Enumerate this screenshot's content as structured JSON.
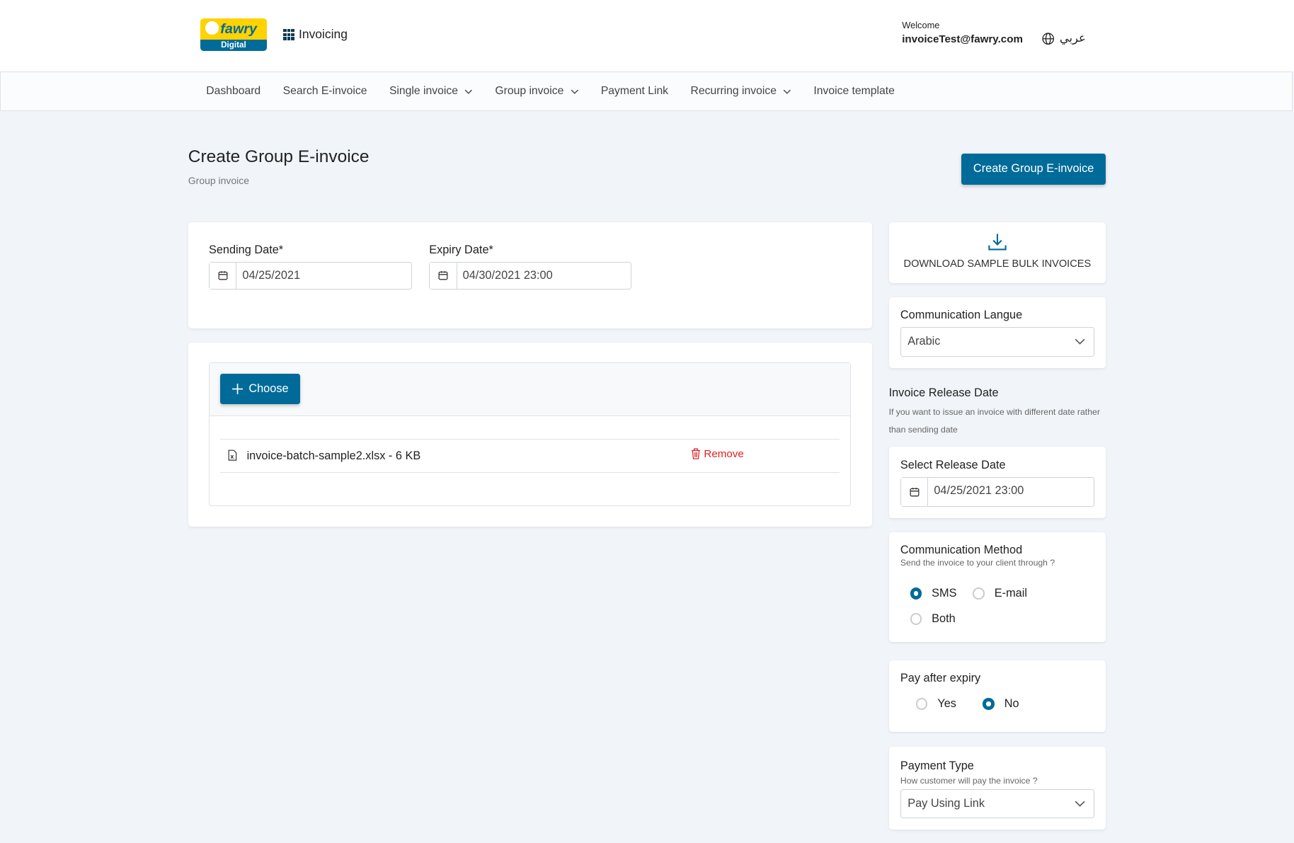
{
  "header": {
    "logo_text": "fawry",
    "logo_sub": "Digital",
    "app_name": "Invoicing",
    "welcome": "Welcome",
    "user_email": "invoiceTest@fawry.com",
    "language_toggle": "عربي"
  },
  "nav": {
    "items": [
      {
        "label": "Dashboard"
      },
      {
        "label": "Search E-invoice"
      },
      {
        "label": "Single invoice",
        "dropdown": true
      },
      {
        "label": "Group invoice",
        "dropdown": true
      },
      {
        "label": "Payment Link"
      },
      {
        "label": "Recurring invoice",
        "dropdown": true
      },
      {
        "label": "Invoice template"
      }
    ]
  },
  "page": {
    "title": "Create Group E-invoice",
    "breadcrumb": "Group invoice",
    "create_button": "Create Group E-invoice"
  },
  "dates": {
    "sending_label": "Sending Date*",
    "sending_value": "04/25/2021",
    "expiry_label": "Expiry Date*",
    "expiry_value": "04/30/2021 23:00"
  },
  "upload": {
    "choose_label": "Choose",
    "file_name": "invoice-batch-sample2.xlsx - 6 KB",
    "remove_label": "Remove"
  },
  "side": {
    "download_label": "DOWNLOAD SAMPLE BULK INVOICES",
    "comm_language_label": "Communication Langue",
    "comm_language_value": "Arabic",
    "release_title": "Invoice Release Date",
    "release_help": "If you want to issue an invoice with different date rather than sending date",
    "select_release_label": "Select Release Date",
    "release_value": "04/25/2021 23:00",
    "comm_method_label": "Communication Method",
    "comm_method_help": "Send the invoice to your client through ?",
    "comm_options": [
      "SMS",
      "E-mail",
      "Both"
    ],
    "comm_selected": "SMS",
    "pay_after_label": "Pay after expiry",
    "pay_after_options": [
      "Yes",
      "No"
    ],
    "pay_after_selected": "No",
    "payment_type_label": "Payment Type",
    "payment_type_help": "How customer will pay the invoice ?",
    "payment_type_value": "Pay Using Link"
  },
  "colors": {
    "primary": "#006b99",
    "danger": "#e02020",
    "logo_yellow": "#ffd200"
  }
}
